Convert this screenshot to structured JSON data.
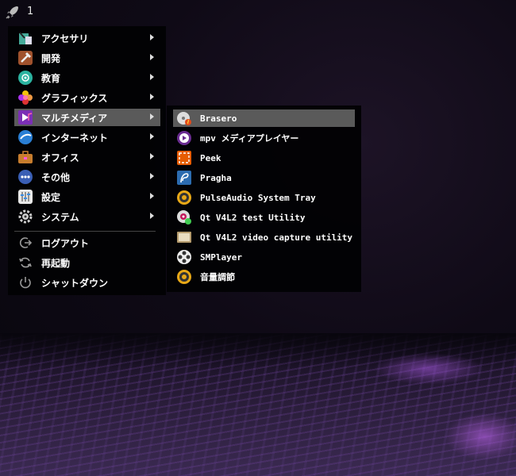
{
  "topbar": {
    "workspace_label": "1",
    "launcher_icon": "rocket-icon"
  },
  "menu": {
    "items": [
      {
        "label": "アクセサリ",
        "icon": "accessories-icon",
        "submenu": true
      },
      {
        "label": "開発",
        "icon": "development-icon",
        "submenu": true
      },
      {
        "label": "教育",
        "icon": "education-icon",
        "submenu": true
      },
      {
        "label": "グラフィックス",
        "icon": "graphics-icon",
        "submenu": true
      },
      {
        "label": "マルチメディア",
        "icon": "multimedia-icon",
        "submenu": true,
        "selected": true
      },
      {
        "label": "インターネット",
        "icon": "internet-icon",
        "submenu": true
      },
      {
        "label": "オフィス",
        "icon": "office-icon",
        "submenu": true
      },
      {
        "label": "その他",
        "icon": "other-icon",
        "submenu": true
      },
      {
        "label": "設定",
        "icon": "settings-icon",
        "submenu": true
      },
      {
        "label": "システム",
        "icon": "system-icon",
        "submenu": true
      }
    ],
    "actions": [
      {
        "label": "ログアウト",
        "icon": "logout-icon"
      },
      {
        "label": "再起動",
        "icon": "restart-icon"
      },
      {
        "label": "シャットダウン",
        "icon": "shutdown-icon"
      }
    ]
  },
  "submenu": {
    "items": [
      {
        "label": "Brasero",
        "icon": "brasero-icon",
        "selected": true
      },
      {
        "label": "mpv メディアプレイヤー",
        "icon": "mpv-icon"
      },
      {
        "label": "Peek",
        "icon": "peek-icon"
      },
      {
        "label": "Pragha",
        "icon": "pragha-icon"
      },
      {
        "label": "PulseAudio System Tray",
        "icon": "pulseaudio-icon"
      },
      {
        "label": "Qt V4L2 test Utility",
        "icon": "qv4l2-icon"
      },
      {
        "label": "Qt V4L2 video capture utility",
        "icon": "qvidcap-icon"
      },
      {
        "label": "SMPlayer",
        "icon": "smplayer-icon"
      },
      {
        "label": "音量調節",
        "icon": "volume-control-icon"
      }
    ]
  },
  "colors": {
    "selected_bg": "#5a5a5a",
    "menu_bg": "#020204"
  }
}
